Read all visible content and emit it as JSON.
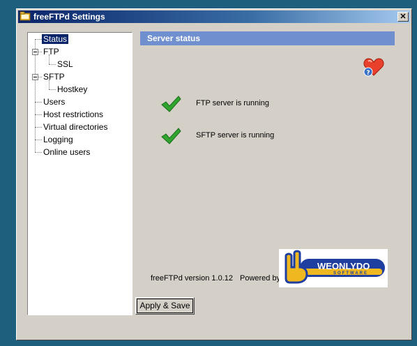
{
  "window": {
    "title": "freeFTPd Settings",
    "close_label": "✕"
  },
  "tree": {
    "items": [
      {
        "label": "Status",
        "selected": true
      },
      {
        "label": "FTP"
      },
      {
        "label": "SSL"
      },
      {
        "label": "SFTP"
      },
      {
        "label": "Hostkey"
      },
      {
        "label": "Users"
      },
      {
        "label": "Host restrictions"
      },
      {
        "label": "Virtual directories"
      },
      {
        "label": "Logging"
      },
      {
        "label": "Online users"
      }
    ]
  },
  "panel": {
    "header": "Server status",
    "statuses": [
      {
        "text": "FTP server is running"
      },
      {
        "text": "SFTP server is running"
      }
    ],
    "version_text": "freeFTPd version 1.0.12",
    "powered_text": "Powered by",
    "logo": {
      "brand": "WEONLYDO",
      "sub": "SOFTWARE"
    }
  },
  "buttons": {
    "apply_label": "Apply & Save"
  },
  "colors": {
    "desktop": "#1f5f7e",
    "title_start": "#0a246a",
    "panel_header": "#6f8fcf",
    "check_green": "#2fa52f"
  }
}
